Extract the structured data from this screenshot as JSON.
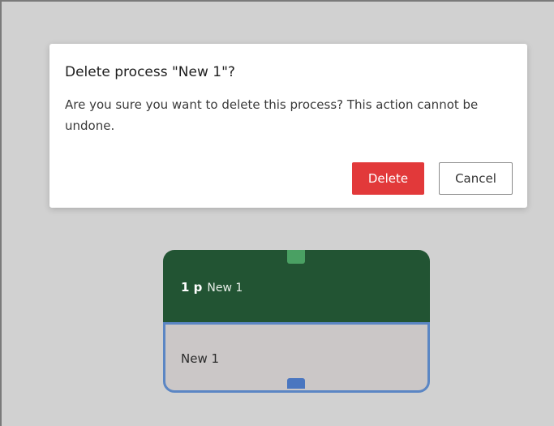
{
  "dialog": {
    "title": "Delete process \"New 1\"?",
    "message": "Are you sure you want to delete this process? This action cannot be undone.",
    "delete_label": "Delete",
    "cancel_label": "Cancel"
  },
  "node": {
    "badge_number": "1 p",
    "header_title": "New 1",
    "body_label": "New 1"
  },
  "colors": {
    "canvas_bg": "#d1d1d1",
    "node_header": "#225433",
    "node_body": "#cbc7c7",
    "node_border": "#5b86c4",
    "port_in": "#4aa063",
    "port_out": "#4a76c0",
    "delete_button": "#e2393a"
  }
}
